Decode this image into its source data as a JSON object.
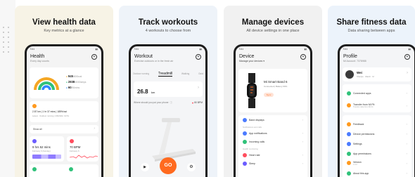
{
  "colors": {
    "health_bg": "#f7f3e6",
    "workouts_bg": "#eef3f9",
    "devices_bg": "#f1f1f1",
    "share_bg": "#ecf3fb",
    "accent_orange": "#ff6a1f",
    "ring_orange": "#f5a623",
    "ring_green": "#30c27a",
    "ring_blue": "#2f88ff"
  },
  "panels": [
    {
      "title": "View health data",
      "subtitle": "Key metrics at a glance",
      "screen": {
        "status_time": "9:41",
        "app_title": "Health",
        "app_subtitle": "Every day counts",
        "metrics": [
          {
            "value": "945",
            "unit": "/800kcal"
          },
          {
            "value": "2838",
            "unit": "/8000steps"
          },
          {
            "value": "60",
            "unit": "/30mins"
          }
        ],
        "activity_line1": "2.87 km | 1 hr 37 mins | 185%/out",
        "activity_line2": "Latest · Outdoor running | 2/8/2022, 19:51",
        "show_all": "Show all",
        "sleep_value": "9 hrs 52 mins",
        "sleep_label": "February 6 (Sunday)",
        "heart_value": "70 BPM",
        "heart_label": "February 6"
      }
    },
    {
      "title": "Track workouts",
      "subtitle": "4 workouts to choose from",
      "screen": {
        "status_time": "9:41",
        "app_title": "Workout",
        "app_subtitle": "Exercise outdoors or in the fresh air",
        "tabs": [
          "Outdoor running",
          "Treadmill",
          "Walking",
          "Outd"
        ],
        "active_tab": 1,
        "distance_value": "26.8",
        "distance_unit": "km",
        "distance_label": "Distance",
        "phone_prompt": "Where should you put your phone",
        "heart_note": "80 BPM",
        "go_label": "GO"
      }
    },
    {
      "title": "Manage devices",
      "subtitle": "All device settings in one place",
      "screen": {
        "status_time": "9:41",
        "app_title": "Device",
        "app_subtitle": "Manage your devices",
        "device_name": "Mi Smart Band 6",
        "device_status": "Connected | Battery 60%",
        "sync_label": "Sync",
        "section1": "Band displays",
        "section2_hint": "Notifications and calls",
        "item_notifications": "App notifications",
        "item_calls": "Incoming calls",
        "section3_hint": "Health monitoring",
        "item_heart": "Heart rate",
        "item_sleep": "Sleep"
      }
    },
    {
      "title": "Share fitness data",
      "subtitle": "Data sharing between apps",
      "screen": {
        "status_time": "9:41",
        "app_title": "Profile",
        "app_subtitle": "Mi Account: 7378988",
        "user_name": "Wei",
        "user_sub": "Sharpie · Watch · M",
        "items": [
          "Connected apps",
          "Transfer from Mi Fit",
          "Feedback",
          "Device permissions",
          "Settings",
          "App permissions",
          "Version",
          "About this app"
        ],
        "transfer_sub": "Transfer data from Mi Fit",
        "version_sub": "1.0.0"
      }
    }
  ]
}
